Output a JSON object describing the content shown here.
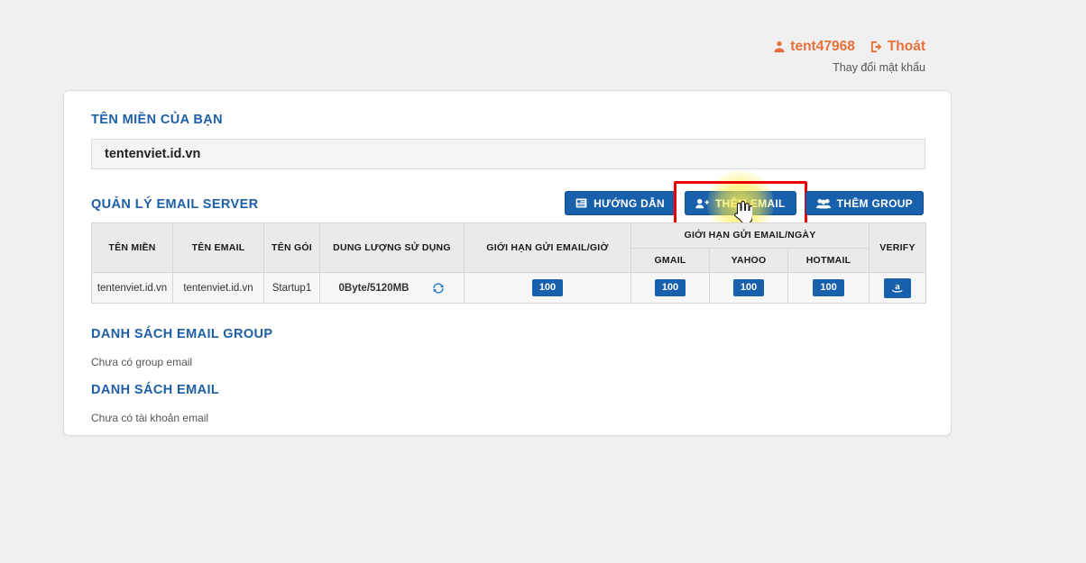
{
  "userbar": {
    "user_icon": "user-icon",
    "username": "tent47968",
    "logout_icon": "sign-out-icon",
    "logout_label": "Thoát",
    "change_password_label": "Thay đổi mật khẩu"
  },
  "domain_section": {
    "heading": "TÊN MIỀN CỦA BẠN",
    "domain_value": "tentenviet.id.vn"
  },
  "email_server": {
    "heading": "QUẢN LÝ EMAIL SERVER",
    "buttons": [
      {
        "label": "HƯỚNG DẪN",
        "icon": "guide-icon",
        "highlighted": false
      },
      {
        "label": "THÊM EMAIL",
        "icon": "add-user-icon",
        "highlighted": true
      },
      {
        "label": "THÊM GROUP",
        "icon": "add-group-icon",
        "highlighted": false
      }
    ]
  },
  "table": {
    "headers": {
      "domain": "TÊN MIỀN",
      "email": "TÊN EMAIL",
      "package": "TÊN GÓI",
      "usage": "DUNG LƯỢNG SỬ DỤNG",
      "limit_hour": "GIỚI HẠN GỬI EMAIL/GIỜ",
      "limit_day": "GIỚI HẠN GỬI EMAIL/NGÀY",
      "gmail": "GMAIL",
      "yahoo": "YAHOO",
      "hotmail": "HOTMAIL",
      "verify": "VERIFY"
    },
    "rows": [
      {
        "domain": "tentenviet.id.vn",
        "email": "tentenviet.id.vn",
        "package": "Startup1",
        "usage": "0Byte/5120MB",
        "refresh_icon": "refresh-icon",
        "limit_hour": "100",
        "gmail": "100",
        "yahoo": "100",
        "hotmail": "100",
        "verify_icon": "amazon-icon"
      }
    ]
  },
  "group_list": {
    "heading": "DANH SÁCH EMAIL GROUP",
    "empty_text": "Chưa có group email"
  },
  "email_list": {
    "heading": "DANH SÁCH EMAIL",
    "empty_text": "Chưa có tài khoản email"
  },
  "colors": {
    "accent_blue": "#1860ab",
    "heading_blue": "#1e5fa8",
    "user_orange": "#e8703a",
    "highlight_red": "#ee0000",
    "page_bg": "#f0f0f0"
  }
}
